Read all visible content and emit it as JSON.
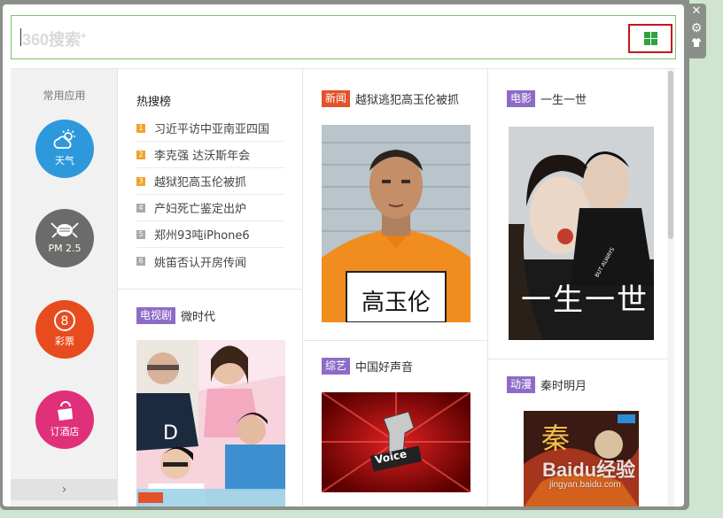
{
  "search": {
    "logo": "360搜索",
    "logo_plus": "+"
  },
  "side_controls": {
    "close": "✕",
    "settings": "⚙",
    "skin": "👕"
  },
  "apps": {
    "title": "常用应用",
    "items": [
      {
        "label": "天气",
        "icon": "weather-icon"
      },
      {
        "label": "PM 2.5",
        "icon": "pm25-icon"
      },
      {
        "label": "彩票",
        "icon": "lottery-icon"
      },
      {
        "label": "订酒店",
        "icon": "hotel-icon"
      }
    ],
    "more": "›"
  },
  "hot": {
    "title": "热搜榜",
    "items": [
      {
        "rank": "1",
        "text": "习近平访中亚南亚四国"
      },
      {
        "rank": "2",
        "text": "李克强 达沃斯年会"
      },
      {
        "rank": "3",
        "text": "越狱犯高玉伦被抓"
      },
      {
        "rank": "4",
        "text": "产妇死亡鉴定出炉"
      },
      {
        "rank": "5",
        "text": "郑州93吨iPhone6"
      },
      {
        "rank": "6",
        "text": "姚笛否认开房传闻"
      }
    ]
  },
  "cards": {
    "tv": {
      "tag": "电视剧",
      "title": "微时代"
    },
    "news": {
      "tag": "新闻",
      "title": "越狱逃犯高玉伦被抓",
      "caption": "高玉伦"
    },
    "variety": {
      "tag": "综艺",
      "title": "中国好声音",
      "logo_text": "Voice"
    },
    "movie": {
      "tag": "电影",
      "title": "一生一世",
      "poster_text": "一生一世",
      "poster_sub": "BUT ALWAYS"
    },
    "anime": {
      "tag": "动漫",
      "title": "秦时明月",
      "poster_text": "秦"
    }
  },
  "watermark": {
    "main": "Baidu经验",
    "sub": "jingyan.baidu.com"
  },
  "colors": {
    "accent": "#2da33b",
    "news_tag": "#e4522a",
    "category_tag": "#8d6cc7",
    "highlight_border": "#c4161c"
  }
}
